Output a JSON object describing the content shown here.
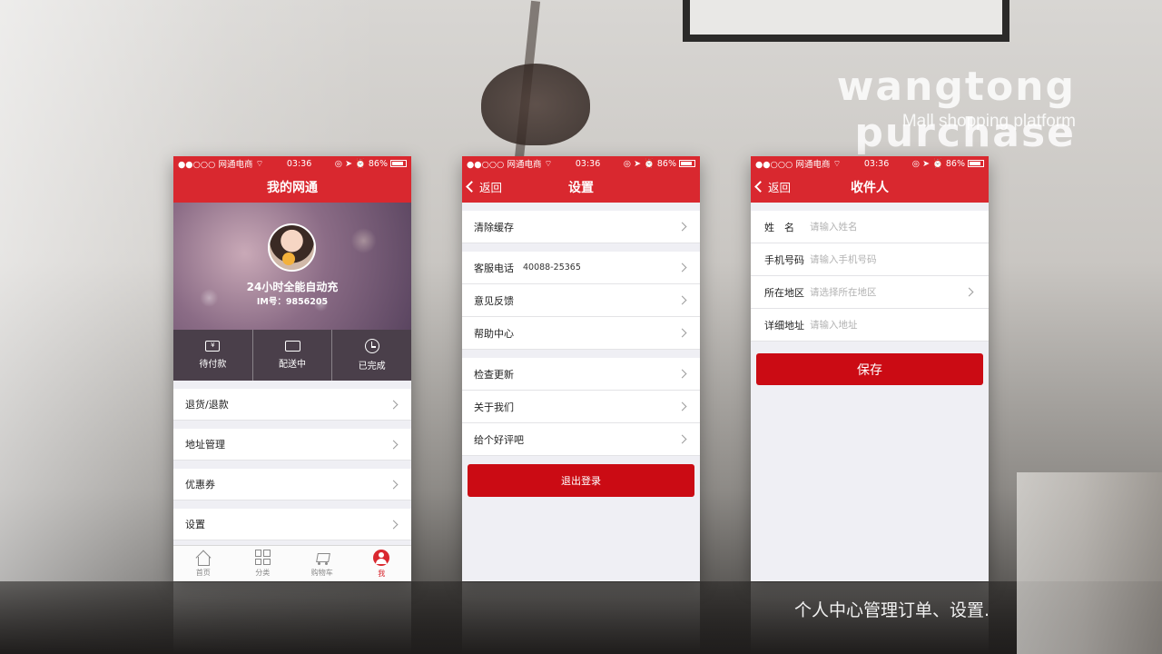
{
  "banner": {
    "headline": "wangtong purchase",
    "subline": "Mall shopping platform",
    "caption": "个人中心管理订单、设置."
  },
  "statusbar": {
    "carrier": "●●○○○ 网通电商",
    "time": "03:36",
    "battery": "86%",
    "battery_level": 0.86
  },
  "screen_profile": {
    "title": "我的网通",
    "user_name": "24小时全能自动充",
    "im_number": "IM号：9856205",
    "orders": [
      {
        "label": "待付款",
        "icon": "wallet-icon"
      },
      {
        "label": "配送中",
        "icon": "truck-icon"
      },
      {
        "label": "已完成",
        "icon": "clock-icon"
      }
    ],
    "menu": [
      {
        "label": "退货/退款"
      },
      {
        "label": "地址管理"
      },
      {
        "label": "优惠券"
      },
      {
        "label": "设置"
      }
    ],
    "tabs": [
      {
        "label": "首页",
        "icon": "home-icon"
      },
      {
        "label": "分类",
        "icon": "grid-icon"
      },
      {
        "label": "购物车",
        "icon": "cart-icon"
      },
      {
        "label": "我",
        "icon": "user-icon",
        "active": true
      }
    ]
  },
  "screen_settings": {
    "back_label": "返回",
    "title": "设置",
    "groups": [
      [
        {
          "label": "清除缓存"
        }
      ],
      [
        {
          "label": "客服电话",
          "extra": "40088-25365"
        },
        {
          "label": "意见反馈"
        },
        {
          "label": "帮助中心"
        }
      ],
      [
        {
          "label": "检查更新"
        },
        {
          "label": "关于我们"
        },
        {
          "label": "给个好评吧"
        }
      ]
    ],
    "logout_label": "退出登录"
  },
  "screen_receiver": {
    "back_label": "返回",
    "title": "收件人",
    "fields": [
      {
        "label": "姓　名",
        "placeholder": "请输入姓名"
      },
      {
        "label": "手机号码",
        "placeholder": "请输入手机号码"
      },
      {
        "label": "所在地区",
        "placeholder": "请选择所在地区",
        "has_arrow": true
      },
      {
        "label": "详细地址",
        "placeholder": "请输入地址"
      }
    ],
    "save_label": "保存"
  },
  "colors": {
    "brand_red": "#d9282f",
    "button_red": "#cb0b14",
    "list_bg": "#efeff4"
  }
}
